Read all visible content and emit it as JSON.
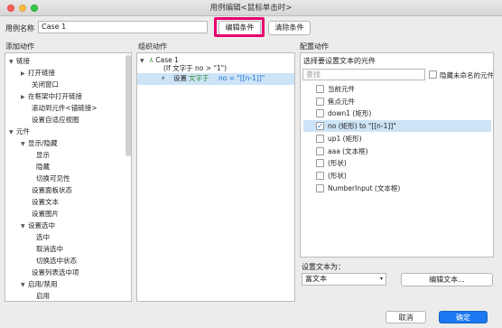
{
  "window": {
    "title": "用例编辑<鼠标单击时>"
  },
  "header": {
    "case_name_label": "用例名称",
    "case_name_value": "Case 1",
    "edit_condition": "编辑条件",
    "clear_condition": "清除条件"
  },
  "left": {
    "title": "添加动作",
    "items": [
      {
        "label": "链接",
        "tri": "▼"
      },
      {
        "label": "打开链接",
        "tri": "▶"
      },
      {
        "label": "关闭窗口",
        "tri": ""
      },
      {
        "label": "在框架中打开链接",
        "tri": "▶"
      },
      {
        "label": "滚动到元件<锚链接>",
        "tri": ""
      },
      {
        "label": "设置自适应视图",
        "tri": ""
      },
      {
        "label": "元件",
        "tri": "▼"
      },
      {
        "label": "显示/隐藏",
        "tri": "▼"
      },
      {
        "label": "显示",
        "tri": ""
      },
      {
        "label": "隐藏",
        "tri": ""
      },
      {
        "label": "切换可见性",
        "tri": ""
      },
      {
        "label": "设置面板状态",
        "tri": ""
      },
      {
        "label": "设置文本",
        "tri": ""
      },
      {
        "label": "设置图片",
        "tri": ""
      },
      {
        "label": "设置选中",
        "tri": "▼"
      },
      {
        "label": "选中",
        "tri": ""
      },
      {
        "label": "取消选中",
        "tri": ""
      },
      {
        "label": "切换选中状态",
        "tri": ""
      },
      {
        "label": "设置列表选中项",
        "tri": ""
      },
      {
        "label": "启用/禁用",
        "tri": "▼"
      },
      {
        "label": "启用",
        "tri": ""
      }
    ]
  },
  "middle": {
    "title": "组织动作",
    "case_label": "Case 1",
    "condition": "(If 文字于 no > \"1\")",
    "action_prefix": "设置",
    "action_mid": "文字于",
    "action_value": "no = \"[[n-1]]\""
  },
  "right": {
    "title": "配置动作",
    "subtitle": "选择要设置文本的元件",
    "search_placeholder": "查找",
    "hide_unnamed": "隐藏未命名的元件",
    "elements": [
      {
        "label": "当前元件",
        "checked": false
      },
      {
        "label": "焦点元件",
        "checked": false
      },
      {
        "label": "down1 (矩形)",
        "checked": false
      },
      {
        "label": "no (矩形) to \"[[n-1]]\"",
        "checked": true
      },
      {
        "label": "up1 (矩形)",
        "checked": false
      },
      {
        "label": "aaa (文本框)",
        "checked": false
      },
      {
        "label": "(形状)",
        "checked": false
      },
      {
        "label": "(形状)",
        "checked": false
      },
      {
        "label": "NumberInput (文本框)",
        "checked": false
      }
    ],
    "set_text_label": "设置文本为：",
    "rich_text_select": "富文本",
    "edit_text_btn": "编辑文本..."
  },
  "footer": {
    "cancel": "取消",
    "ok": "确定"
  },
  "colors": {
    "accent": "#1a6fd8",
    "highlight": "#e8006d",
    "selection": "#cde3f6"
  }
}
